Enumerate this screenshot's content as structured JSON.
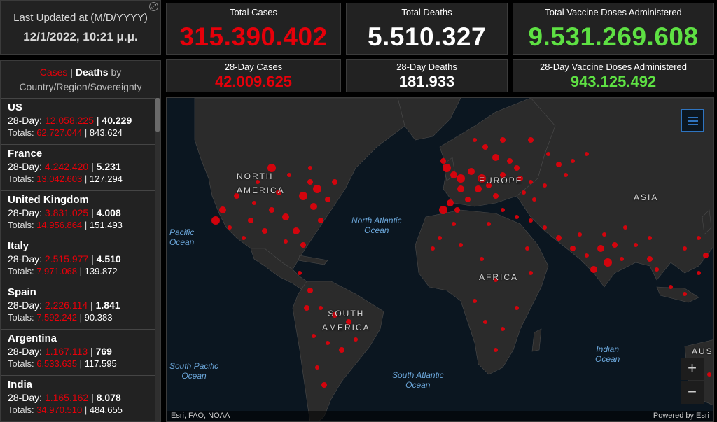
{
  "last_updated": {
    "label": "Last Updated at (M/D/YYYY)",
    "value": "12/1/2022, 10:21 μ.μ."
  },
  "totals": {
    "cases": {
      "label": "Total Cases",
      "value": "315.390.402"
    },
    "deaths": {
      "label": "Total Deaths",
      "value": "5.510.327"
    },
    "vaccine": {
      "label": "Total Vaccine Doses Administered",
      "value": "9.531.269.608"
    }
  },
  "day28": {
    "cases": {
      "label": "28-Day Cases",
      "value": "42.009.625"
    },
    "deaths": {
      "label": "28-Day Deaths",
      "value": "181.933"
    },
    "vaccine": {
      "label": "28-Day Vaccine Doses Administered",
      "value": "943.125.492"
    }
  },
  "list_header": {
    "cases_tab": "Cases",
    "separator": "|",
    "deaths_tab": "Deaths",
    "by_text": "by",
    "line2": "Country/Region/Sovereignty"
  },
  "list_labels": {
    "day28": "28-Day: ",
    "totals": "Totals: ",
    "sep": "|"
  },
  "countries": [
    {
      "name": "US",
      "day28_cases": "12.058.225",
      "day28_deaths": "40.229",
      "total_cases": "62.727.044",
      "total_deaths": "843.624"
    },
    {
      "name": "France",
      "day28_cases": "4.242.420",
      "day28_deaths": "5.231",
      "total_cases": "13.042.603",
      "total_deaths": "127.294"
    },
    {
      "name": "United Kingdom",
      "day28_cases": "3.831.025",
      "day28_deaths": "4.008",
      "total_cases": "14.956.864",
      "total_deaths": "151.493"
    },
    {
      "name": "Italy",
      "day28_cases": "2.515.977",
      "day28_deaths": "4.510",
      "total_cases": "7.971.068",
      "total_deaths": "139.872"
    },
    {
      "name": "Spain",
      "day28_cases": "2.226.114",
      "day28_deaths": "1.841",
      "total_cases": "7.592.242",
      "total_deaths": "90.383"
    },
    {
      "name": "Argentina",
      "day28_cases": "1.167.113",
      "day28_deaths": "769",
      "total_cases": "6.533.635",
      "total_deaths": "117.595"
    },
    {
      "name": "India",
      "day28_cases": "1.165.162",
      "day28_deaths": "8.078",
      "total_cases": "34.970.510",
      "total_deaths": "484.655"
    }
  ],
  "map": {
    "labels": {
      "north_america": [
        "NORTH",
        "AMERICA"
      ],
      "europe": "EUROPE",
      "asia": "ASIA",
      "africa": "AFRICA",
      "south_america": [
        "SOUTH",
        "AMERICA"
      ],
      "aus": "AUS"
    },
    "oceans": {
      "pacific": [
        "Pacific",
        "Ocean"
      ],
      "north_atlantic": [
        "North Atlantic",
        "Ocean"
      ],
      "south_pacific": [
        "South Pacific",
        "Ocean"
      ],
      "south_atlantic": [
        "South Atlantic",
        "Ocean"
      ],
      "indian": [
        "Indian",
        "Ocean"
      ]
    },
    "zoom_in": "+",
    "zoom_out": "−",
    "attribution_left": "Esri, FAO, NOAA",
    "attribution_right": "Powered by Esri"
  },
  "colors": {
    "cases": "#e6000a",
    "deaths": "#ffffff",
    "vaccine": "#5ee043",
    "panel": "#222222",
    "ocean": "#0b1620",
    "land": "#2b2b2b"
  }
}
